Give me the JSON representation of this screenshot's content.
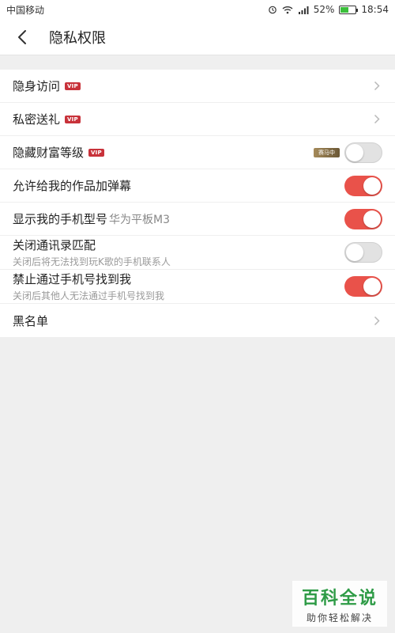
{
  "status_bar": {
    "carrier": "中国移动",
    "battery_percent": "52%",
    "time": "18:54"
  },
  "header": {
    "title": "隐私权限"
  },
  "settings": [
    {
      "label": "隐身访问",
      "vip": "VIP",
      "control": "chevron"
    },
    {
      "label": "私密送礼",
      "vip": "VIP",
      "control": "chevron"
    },
    {
      "label": "隐藏财富等级",
      "vip": "VIP",
      "badge": "赛马中",
      "control": "toggle",
      "on": false
    },
    {
      "label": "允许给我的作品加弹幕",
      "control": "toggle",
      "on": true
    },
    {
      "label": "显示我的手机型号",
      "hint": "华为平板M3",
      "control": "toggle",
      "on": true
    },
    {
      "label": "关闭通讯录匹配",
      "sub": "关闭后将无法找到玩K歌的手机联系人",
      "control": "toggle",
      "on": false
    },
    {
      "label": "禁止通过手机号找到我",
      "sub": "关闭后其他人无法通过手机号找到我",
      "control": "toggle",
      "on": true
    },
    {
      "label": "黑名单",
      "control": "chevron"
    }
  ],
  "watermark": {
    "main": "百科全说",
    "sub": "助你轻松解决"
  },
  "colors": {
    "toggle_on": "#e9524a",
    "vip_badge": "#c8323a",
    "watermark": "#2e9b46"
  }
}
